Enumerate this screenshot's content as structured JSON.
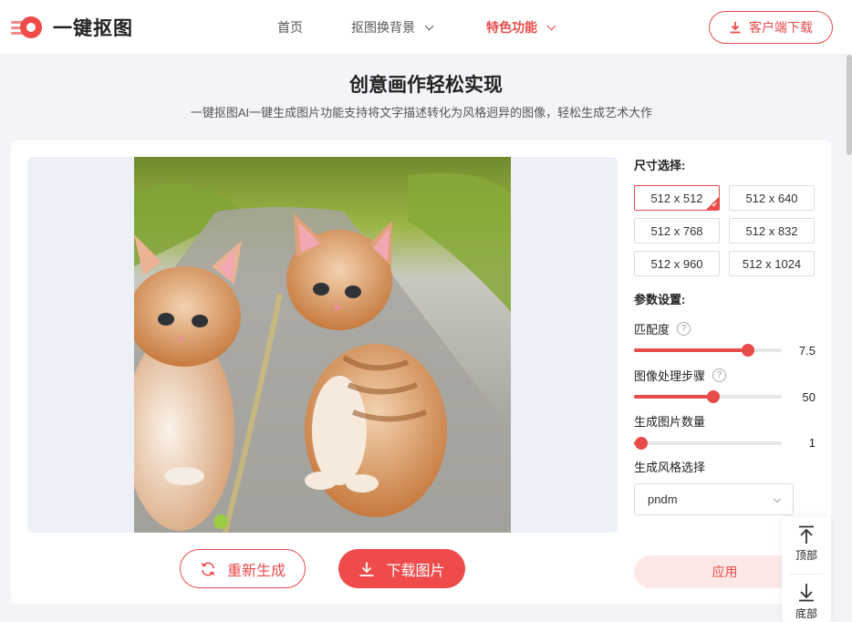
{
  "header": {
    "brand": "一键抠图",
    "nav": [
      {
        "label": "首页"
      },
      {
        "label": "抠图换背景"
      },
      {
        "label": "特色功能"
      }
    ],
    "client_download": "客户端下载"
  },
  "hero": {
    "title": "创意画作轻松实现",
    "subtitle": "一键抠图AI一键生成图片功能支持将文字描述转化为风格迥异的图像，轻松生成艺术大作"
  },
  "actions": {
    "regenerate": "重新生成",
    "download": "下载图片"
  },
  "settings": {
    "size_label": "尺寸选择:",
    "sizes": [
      "512 x 512",
      "512 x 640",
      "512 x 768",
      "512 x 832",
      "512 x 960",
      "512 x 1024"
    ],
    "selected_size": "512 x 512",
    "param_label": "参数设置:",
    "params": [
      {
        "label": "匹配度",
        "value": "7.5",
        "fill": 0.77,
        "help": true
      },
      {
        "label": "图像处理步骤",
        "value": "50",
        "fill": 0.54,
        "help": true
      },
      {
        "label": "生成图片数量",
        "value": "1",
        "fill": 0.05,
        "help": false
      }
    ],
    "help_glyph": "?",
    "style_label": "生成风格选择",
    "style_value": "pndm",
    "apply": "应用"
  },
  "float": {
    "top": "顶部",
    "bottom": "底部"
  },
  "colors": {
    "accent": "#e84b4b",
    "apply_bg": "#fde8e8"
  }
}
